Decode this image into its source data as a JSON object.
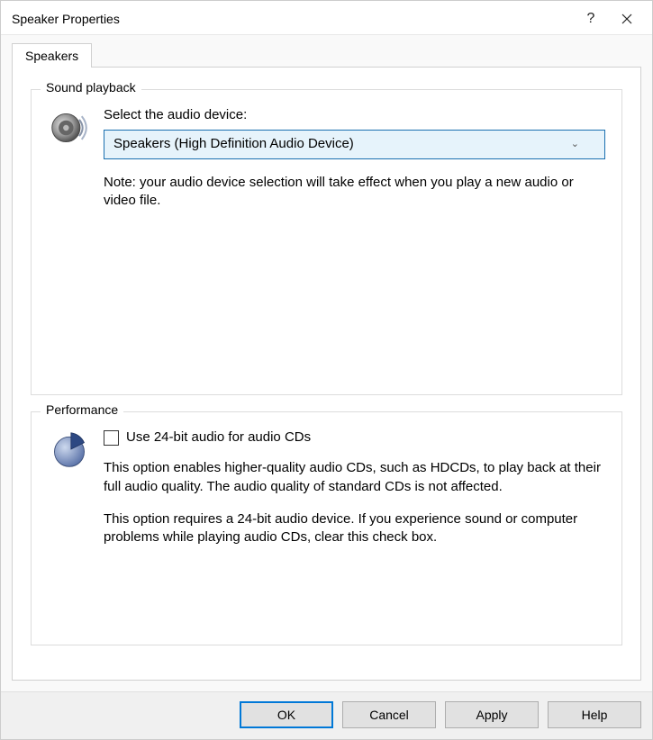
{
  "window": {
    "title": "Speaker Properties"
  },
  "tab": {
    "label": "Speakers"
  },
  "playback": {
    "legend": "Sound playback",
    "select_label": "Select the audio device:",
    "device_selected": "Speakers (High Definition Audio Device)",
    "note": "Note: your audio device selection will take effect when you play a new audio or video file."
  },
  "performance": {
    "legend": "Performance",
    "checkbox_label": "Use 24-bit audio for audio CDs",
    "desc1": "This option enables higher-quality audio CDs, such as HDCDs, to play back at their full audio quality. The audio quality of standard CDs is not affected.",
    "desc2": "This option requires a 24-bit audio device. If you experience sound or computer problems while playing audio CDs, clear this check box."
  },
  "buttons": {
    "ok": "OK",
    "cancel": "Cancel",
    "apply": "Apply",
    "help": "Help"
  }
}
